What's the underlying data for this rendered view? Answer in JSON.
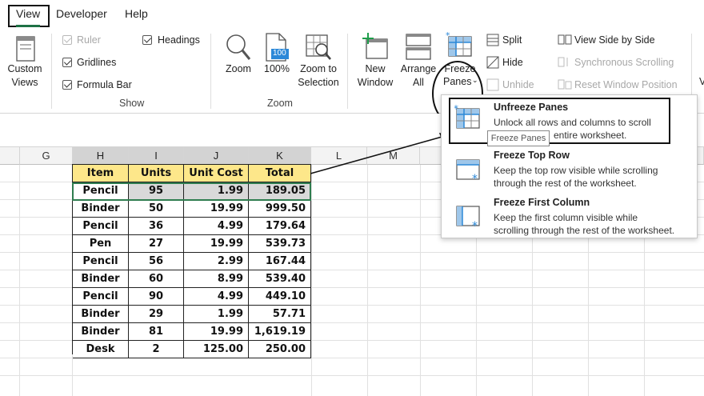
{
  "tabs": {
    "view": "View",
    "developer": "Developer",
    "help": "Help"
  },
  "ribbon": {
    "custom_views": [
      "Custom",
      "Views"
    ],
    "show": {
      "ruler": "Ruler",
      "gridlines": "Gridlines",
      "formula_bar": "Formula Bar",
      "headings": "Headings",
      "title": "Show"
    },
    "zoom": {
      "zoom": "Zoom",
      "hundred": "100%",
      "hundred_icon": "100",
      "zoom_to_selection": [
        "Zoom to",
        "Selection"
      ],
      "title": "Zoom"
    },
    "window": {
      "new_window": [
        "New",
        "Window"
      ],
      "arrange_all": [
        "Arrange",
        "All"
      ],
      "freeze_panes": [
        "Freeze",
        "Panes"
      ],
      "split": "Split",
      "hide": "Hide",
      "unhide": "Unhide",
      "view_side_by_side": "View Side by Side",
      "synchronous_scrolling": "Synchronous Scrolling",
      "reset_window_position": "Reset Window Position"
    }
  },
  "columns": [
    "G",
    "H",
    "I",
    "J",
    "K",
    "L",
    "M"
  ],
  "table": {
    "headers": [
      "Item",
      "Units",
      "Unit Cost",
      "Total"
    ],
    "rows": [
      [
        "Pencil",
        "95",
        "1.99",
        "189.05"
      ],
      [
        "Binder",
        "50",
        "19.99",
        "999.50"
      ],
      [
        "Pencil",
        "36",
        "4.99",
        "179.64"
      ],
      [
        "Pen",
        "27",
        "19.99",
        "539.73"
      ],
      [
        "Pencil",
        "56",
        "2.99",
        "167.44"
      ],
      [
        "Binder",
        "60",
        "8.99",
        "539.40"
      ],
      [
        "Pencil",
        "90",
        "4.99",
        "449.10"
      ],
      [
        "Binder",
        "29",
        "1.99",
        "57.71"
      ],
      [
        "Binder",
        "81",
        "19.99",
        "1,619.19"
      ],
      [
        "Desk",
        "2",
        "125.00",
        "250.00"
      ]
    ]
  },
  "menu": {
    "unfreeze": {
      "title": "Unfreeze Panes",
      "desc_1": "Unlock all rows and columns to scroll",
      "desc_2": "entire worksheet."
    },
    "freeze_top_row": {
      "title": "Freeze Top Row",
      "desc_1": "Keep the top row visible while scrolling",
      "desc_2": "through the rest of the worksheet."
    },
    "freeze_first_column": {
      "title": "Freeze First Column",
      "desc_1": "Keep the first column visible while",
      "desc_2": "scrolling through the rest of the worksheet."
    }
  },
  "tooltip": "Freeze Panes",
  "colors": {
    "accent_green": "#1e7145",
    "header_fill": "#fde78a",
    "selected_row_fill": "#d9d9d9",
    "icon_blue": "#2b88d8"
  }
}
